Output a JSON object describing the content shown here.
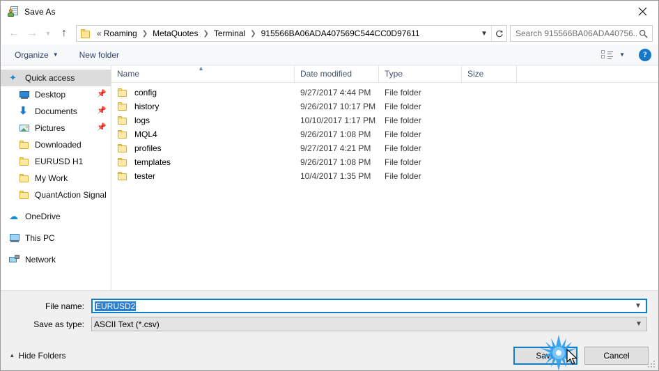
{
  "window": {
    "title": "Save As",
    "title_icon": "save-as-icon",
    "close_icon": "close-icon"
  },
  "navigation": {
    "back_icon": "arrow-left-icon",
    "back_label": "Back",
    "forward_icon": "arrow-right-icon",
    "forward_label": "Forward",
    "recent_icon": "chevron-down-icon",
    "recent_label": "Recent locations",
    "up_icon": "arrow-up-icon",
    "up_label": "Up one level",
    "address": {
      "folder_icon": "folder-icon",
      "overflow": "«",
      "crumbs": [
        "Roaming",
        "MetaQuotes",
        "Terminal",
        "915566BA06ADA407569C544CC0D97611"
      ],
      "separator": "❯",
      "dropdown_icon": "chevron-down-icon",
      "refresh_icon": "refresh-icon"
    },
    "search": {
      "placeholder": "Search 915566BA06ADA40756...",
      "icon": "search-icon"
    }
  },
  "toolbar": {
    "organize_label": "Organize",
    "organize_caret": "▼",
    "new_folder_label": "New folder",
    "view_icon": "view-layout-icon",
    "view_caret": "▼",
    "help_icon": "help-icon",
    "help_label": "?"
  },
  "sidebar": {
    "items": [
      {
        "label": "Quick access",
        "icon": "star-pin-icon",
        "selected": true,
        "indent": false,
        "pinned": false,
        "group": false
      },
      {
        "label": "Desktop",
        "icon": "desktop-icon",
        "selected": false,
        "indent": true,
        "pinned": true,
        "group": false
      },
      {
        "label": "Documents",
        "icon": "documents-download-icon",
        "selected": false,
        "indent": true,
        "pinned": true,
        "group": false
      },
      {
        "label": "Pictures",
        "icon": "pictures-icon",
        "selected": false,
        "indent": true,
        "pinned": true,
        "group": false
      },
      {
        "label": "Downloaded",
        "icon": "folder-icon",
        "selected": false,
        "indent": true,
        "pinned": false,
        "group": false
      },
      {
        "label": "EURUSD H1",
        "icon": "folder-icon",
        "selected": false,
        "indent": true,
        "pinned": false,
        "group": false
      },
      {
        "label": "My Work",
        "icon": "folder-icon",
        "selected": false,
        "indent": true,
        "pinned": false,
        "group": false
      },
      {
        "label": "QuantAction Signal",
        "icon": "folder-icon",
        "selected": false,
        "indent": true,
        "pinned": false,
        "group": false
      },
      {
        "label": "OneDrive",
        "icon": "onedrive-cloud-icon",
        "selected": false,
        "indent": false,
        "pinned": false,
        "group": true
      },
      {
        "label": "This PC",
        "icon": "this-pc-icon",
        "selected": false,
        "indent": false,
        "pinned": false,
        "group": true
      },
      {
        "label": "Network",
        "icon": "network-icon",
        "selected": false,
        "indent": false,
        "pinned": false,
        "group": true
      }
    ],
    "pin_glyph": "📌"
  },
  "filelist": {
    "columns": [
      "Name",
      "Date modified",
      "Type",
      "Size"
    ],
    "sort_column": "Name",
    "sort_indicator": "▴",
    "rows": [
      {
        "name": "config",
        "date": "9/27/2017 4:44 PM",
        "type": "File folder",
        "size": "",
        "icon": "folder-icon"
      },
      {
        "name": "history",
        "date": "9/26/2017 10:17 PM",
        "type": "File folder",
        "size": "",
        "icon": "folder-icon"
      },
      {
        "name": "logs",
        "date": "10/10/2017 1:17 PM",
        "type": "File folder",
        "size": "",
        "icon": "folder-icon"
      },
      {
        "name": "MQL4",
        "date": "9/26/2017 1:08 PM",
        "type": "File folder",
        "size": "",
        "icon": "folder-icon"
      },
      {
        "name": "profiles",
        "date": "9/27/2017 4:21 PM",
        "type": "File folder",
        "size": "",
        "icon": "folder-icon"
      },
      {
        "name": "templates",
        "date": "9/26/2017 1:08 PM",
        "type": "File folder",
        "size": "",
        "icon": "folder-icon"
      },
      {
        "name": "tester",
        "date": "10/4/2017 1:35 PM",
        "type": "File folder",
        "size": "",
        "icon": "folder-icon"
      }
    ]
  },
  "form": {
    "file_name_label": "File name:",
    "file_name_value": "EURUSD2",
    "file_name_selected": true,
    "file_type_label": "Save as type:",
    "file_type_value": "ASCII Text (*.csv)",
    "dropdown_icon": "chevron-down-icon"
  },
  "footer": {
    "hide_folders_label": "Hide Folders",
    "hide_folders_caret": "▴",
    "save_label": "Save",
    "cancel_label": "Cancel",
    "resize_grip": "resize-grip-icon"
  },
  "overlay": {
    "click_effect": "click-starburst",
    "cursor": "mouse-cursor-arrow",
    "accent_color": "#0f7ec8",
    "selection_color": "#2a7fd4",
    "click_color": "#1d8ef0"
  }
}
